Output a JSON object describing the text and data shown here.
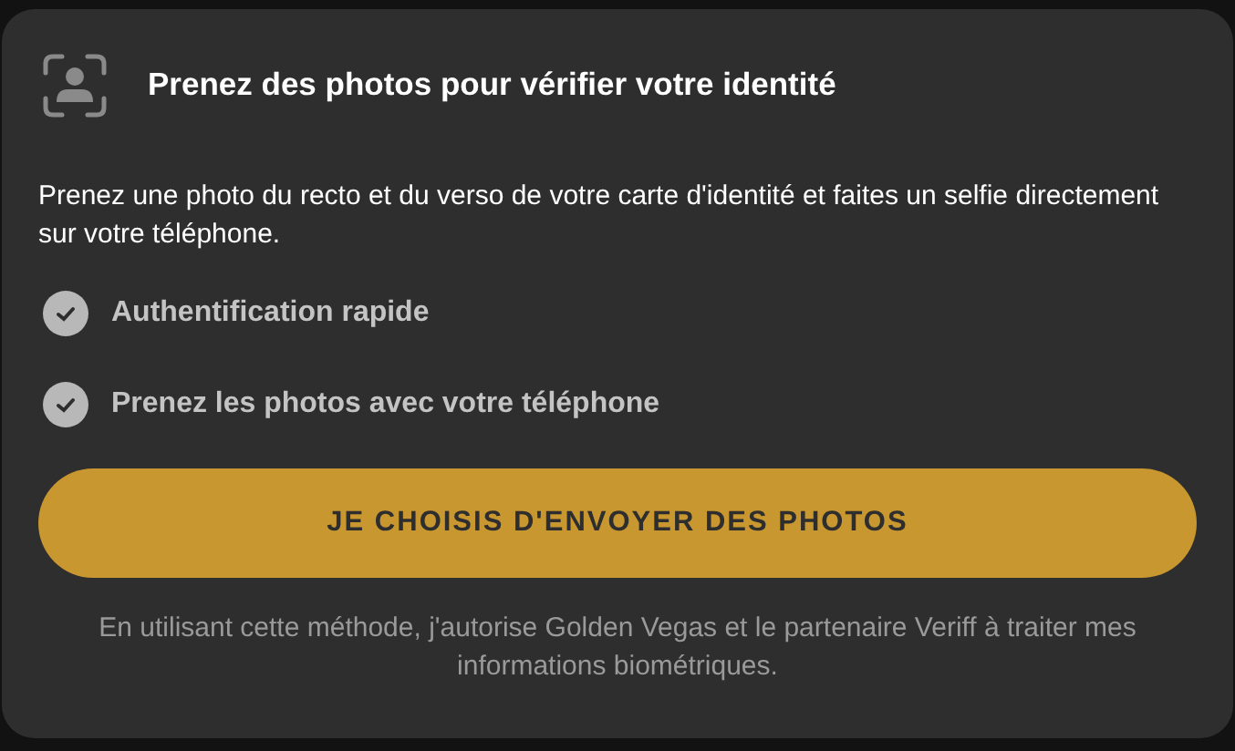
{
  "title": "Prenez des photos pour vérifier votre identité",
  "description": "Prenez une photo du recto et du verso de votre carte d'identité et faites un selfie directement sur votre téléphone.",
  "features": [
    {
      "label": "Authentification rapide",
      "checked": true
    },
    {
      "label": "Prenez les photos avec votre téléphone",
      "checked": true
    }
  ],
  "button": "JE CHOISIS D'ENVOYER DES PHOTOS",
  "disclaimer": "En utilisant cette méthode, j'autorise Golden Vegas et le partenaire Veriff à traiter mes informations biométriques."
}
